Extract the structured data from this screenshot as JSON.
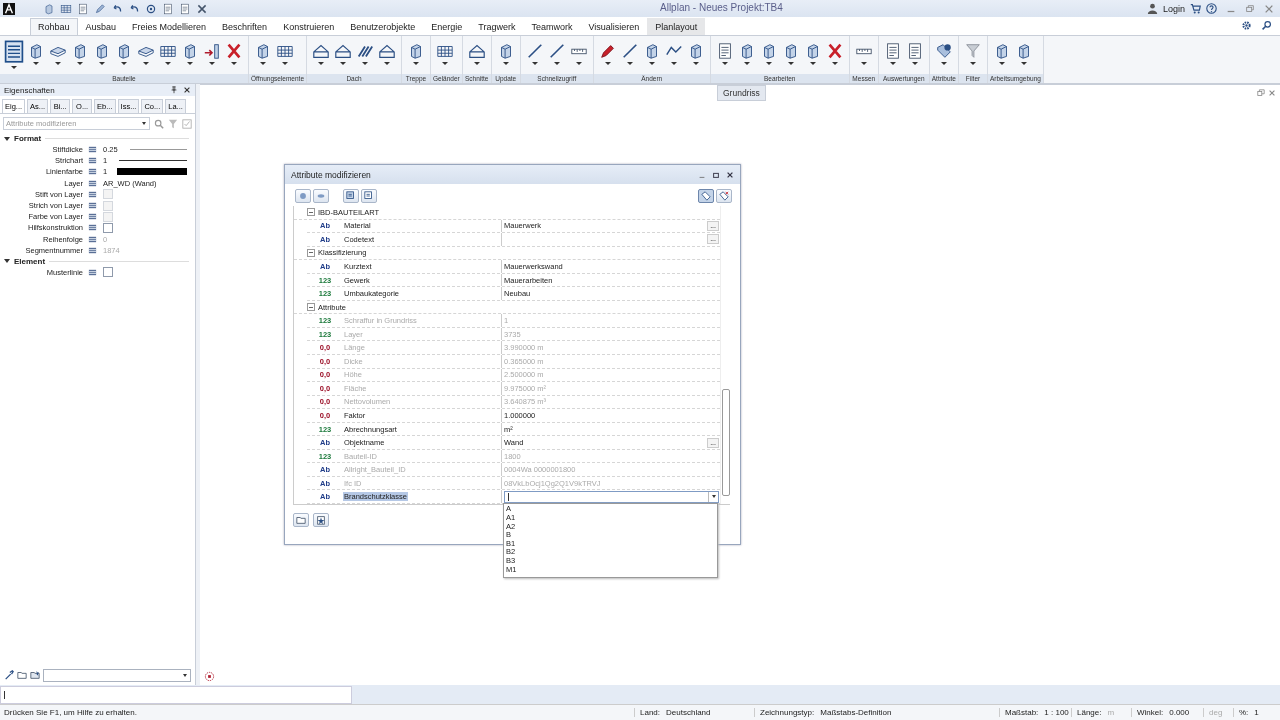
{
  "title_bar": {
    "title": "Allplan - Neues Projekt:TB4",
    "login": "Login"
  },
  "ribbon_tabs": [
    {
      "label": "Rohbau",
      "selected": true
    },
    {
      "label": "Ausbau",
      "selected": false
    },
    {
      "label": "Freies Modellieren",
      "selected": false
    },
    {
      "label": "Beschriften",
      "selected": false
    },
    {
      "label": "Konstruieren",
      "selected": false
    },
    {
      "label": "Benutzerobjekte",
      "selected": false
    },
    {
      "label": "Energie",
      "selected": false
    },
    {
      "label": "Tragwerk",
      "selected": false
    },
    {
      "label": "Teamwork",
      "selected": false
    },
    {
      "label": "Visualisieren",
      "selected": false
    },
    {
      "label": "Planlayout",
      "selected": false
    }
  ],
  "ribbon_groups": [
    {
      "label": "Bauteile"
    },
    {
      "label": "Öffnungselemente"
    },
    {
      "label": "Dach"
    },
    {
      "label": "Treppe"
    },
    {
      "label": "Geländer"
    },
    {
      "label": "Schnitte"
    },
    {
      "label": "Update"
    },
    {
      "label": "Schnellzugriff"
    },
    {
      "label": "Ändern"
    },
    {
      "label": "Bearbeiten"
    },
    {
      "label": "Messen"
    },
    {
      "label": "Auswertungen"
    },
    {
      "label": "Attribute"
    },
    {
      "label": "Filter"
    },
    {
      "label": "Arbeitsumgebung"
    }
  ],
  "properties_panel": {
    "title": "Eigenschaften",
    "tabs": [
      {
        "label": "Eig...",
        "selected": true
      },
      {
        "label": "As...",
        "selected": false
      },
      {
        "label": "Bi...",
        "selected": false
      },
      {
        "label": "O...",
        "selected": false
      },
      {
        "label": "Eb...",
        "selected": false
      },
      {
        "label": "Iss...",
        "selected": false
      },
      {
        "label": "Co...",
        "selected": false
      },
      {
        "label": "La...",
        "selected": false
      }
    ],
    "filter_value": "Attribute modifizieren",
    "sections": [
      {
        "title": "Format",
        "expanded": true,
        "rows": [
          {
            "label": "Stiftdicke",
            "kind": "line",
            "value": "0.25",
            "disabled": false
          },
          {
            "label": "Strichart",
            "kind": "line",
            "value": "1",
            "disabled": false
          },
          {
            "label": "Linienfarbe",
            "kind": "color",
            "value": "1",
            "disabled": false
          },
          {
            "label": "Layer",
            "kind": "text",
            "value": "AR_WD (Wand)",
            "disabled": false
          },
          {
            "label": "Stift von Layer",
            "kind": "checkbox",
            "checked": false,
            "disabled": true
          },
          {
            "label": "Strich von Layer",
            "kind": "checkbox",
            "checked": false,
            "disabled": true
          },
          {
            "label": "Farbe von Layer",
            "kind": "checkbox",
            "checked": false,
            "disabled": true
          },
          {
            "label": "Hilfskonstruktion",
            "kind": "checkbox",
            "checked": false,
            "disabled": false
          },
          {
            "label": "Reihenfolge",
            "kind": "text",
            "value": "0",
            "disabled": true
          },
          {
            "label": "Segmentnummer",
            "kind": "text",
            "value": "1874",
            "disabled": true
          }
        ]
      },
      {
        "title": "Element",
        "expanded": true,
        "rows": [
          {
            "label": "Musterlinie",
            "kind": "checkbox",
            "checked": false,
            "disabled": false
          }
        ]
      }
    ]
  },
  "view_tab": "Grundriss",
  "dialog": {
    "title": "Attribute modifizieren",
    "groups": [
      {
        "title": "IBD-BAUTEILART",
        "expanded": true,
        "rows": [
          {
            "kind": "text",
            "badge": "Ab",
            "name": "Material",
            "value": "Mauerwerk",
            "more": "...",
            "disabled": false,
            "selected": false
          },
          {
            "kind": "text",
            "badge": "Ab",
            "name": "Codetext",
            "more": "...",
            "disabled": false,
            "selected": false
          }
        ]
      },
      {
        "title": "Klassifizierung",
        "expanded": true,
        "rows": [
          {
            "kind": "text",
            "badge": "Ab",
            "name": "Kurztext",
            "value": "Mauerwerkswand",
            "disabled": false,
            "selected": false
          },
          {
            "kind": "integer",
            "badge": "123",
            "name": "Gewerk",
            "value": "Mauerarbeiten",
            "disabled": false,
            "selected": false
          },
          {
            "kind": "integer",
            "badge": "123",
            "name": "Umbaukategorie",
            "value": "Neubau",
            "disabled": false,
            "selected": false
          }
        ]
      },
      {
        "title": "Attribute",
        "expanded": true,
        "rows": [
          {
            "kind": "integer",
            "badge": "123",
            "name": "Schraffur in Grundriss",
            "value": "1",
            "disabled": true,
            "selected": false
          },
          {
            "kind": "integer",
            "badge": "123",
            "name": "Layer",
            "value": "3735",
            "disabled": true,
            "selected": false
          },
          {
            "kind": "real",
            "badge": "0,0",
            "name": "Länge",
            "value": "3.990000 m",
            "disabled": true,
            "selected": false
          },
          {
            "kind": "real",
            "badge": "0,0",
            "name": "Dicke",
            "value": "0.365000 m",
            "disabled": true,
            "selected": false
          },
          {
            "kind": "real",
            "badge": "0,0",
            "name": "Höhe",
            "value": "2.500000 m",
            "disabled": true,
            "selected": false
          },
          {
            "kind": "real",
            "badge": "0,0",
            "name": "Fläche",
            "value": "9.975000 m²",
            "disabled": true,
            "selected": false
          },
          {
            "kind": "real",
            "badge": "0,0",
            "name": "Nettovolumen",
            "value": "3.640875 m³",
            "disabled": true,
            "selected": false
          },
          {
            "kind": "real",
            "badge": "0,0",
            "name": "Faktor",
            "value": "1.000000",
            "disabled": false,
            "selected": false
          },
          {
            "kind": "integer",
            "badge": "123",
            "name": "Abrechnungsart",
            "value": "m²",
            "disabled": false,
            "selected": false
          },
          {
            "kind": "text",
            "badge": "Ab",
            "name": "Objektname",
            "value": "Wand",
            "more": "...",
            "disabled": false,
            "selected": false
          },
          {
            "kind": "integer",
            "badge": "123",
            "name": "Bauteil-ID",
            "value": "1800",
            "disabled": true,
            "selected": false
          },
          {
            "kind": "text",
            "badge": "Ab",
            "name": "Allright_Bauteil_ID",
            "value": "0004Wa 0000001800",
            "disabled": true,
            "selected": false
          },
          {
            "kind": "text",
            "badge": "Ab",
            "name": "Ifc ID",
            "value": "08VkLbOcj1Qg2Q1V9kTRVJ",
            "disabled": true,
            "selected": false
          },
          {
            "kind": "text",
            "badge": "Ab",
            "name": "Brandschutzklasse",
            "disabled": false,
            "selected": true,
            "dropdown": {
              "open": true,
              "options": [
                "A",
                "A1",
                "A2",
                "B",
                "B1",
                "B2",
                "B3",
                "M1"
              ]
            }
          }
        ]
      }
    ]
  },
  "status_bar": {
    "hint": "Drücken Sie F1, um Hilfe zu erhalten.",
    "fields": [
      {
        "label": "Land:",
        "value": "Deutschland",
        "disabled": false
      },
      {
        "label": "Zeichnungstyp:",
        "value": "Maßstabs-Definition",
        "disabled": false
      },
      {
        "label": "Maßstab:",
        "value": "1 : 100",
        "disabled": false
      },
      {
        "label": "Länge:",
        "value": "m",
        "disabled": true
      },
      {
        "label": "Winkel:",
        "value": "0.000",
        "disabled": false
      },
      {
        "label": "deg",
        "disabled": true
      },
      {
        "label": "%:",
        "value": "1",
        "disabled": false
      }
    ]
  }
}
